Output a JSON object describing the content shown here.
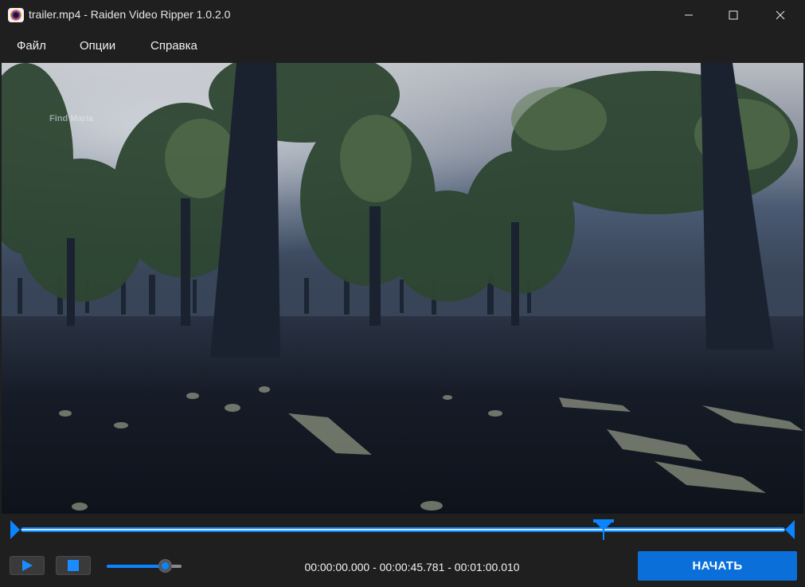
{
  "window": {
    "title": "trailer.mp4 - Raiden Video Ripper 1.0.2.0",
    "app_icon": "raiden-app-icon",
    "controls": [
      "minimize-icon",
      "maximize-icon",
      "close-icon"
    ]
  },
  "menu": {
    "items": [
      {
        "label": "Файл"
      },
      {
        "label": "Опции"
      },
      {
        "label": "Справка"
      }
    ]
  },
  "video": {
    "watermark": "Find Maria"
  },
  "timeline": {
    "selection_start_fraction": 0.0,
    "position_fraction": 0.7627,
    "selection_end_fraction": 1.0,
    "accent": "#0a84ff"
  },
  "controls": {
    "play_icon": "play-icon",
    "stop_icon": "stop-icon",
    "volume_level": 0.78,
    "time_range": "00:00:00.000 - 00:00:45.781 - 00:01:00.010",
    "start_label": "НАЧАТЬ",
    "accent": "#0a6fd8"
  }
}
